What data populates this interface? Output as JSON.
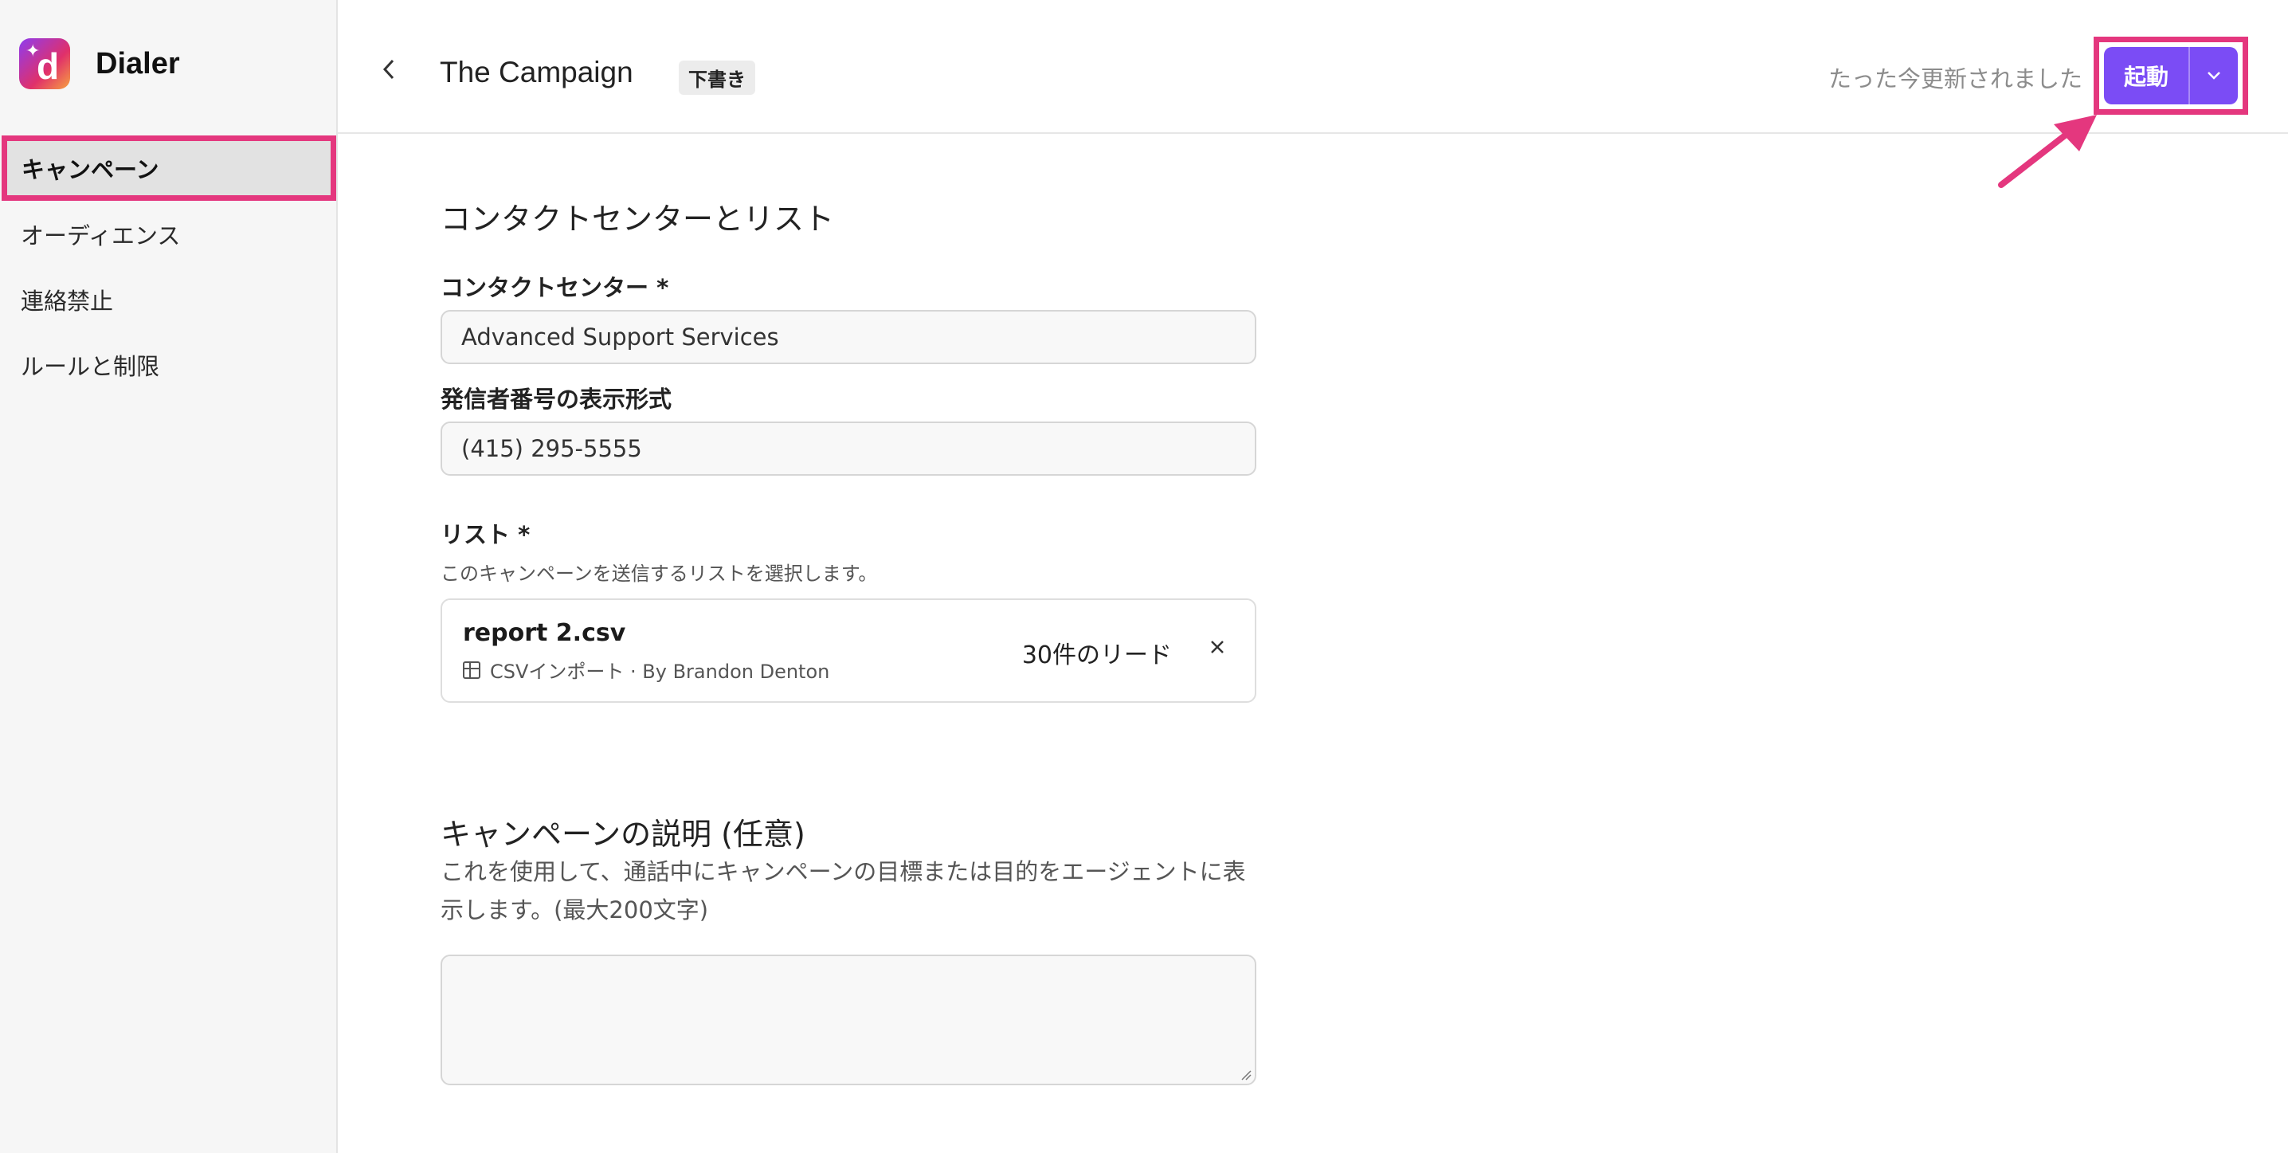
{
  "app": {
    "name": "Dialer"
  },
  "sidebar": {
    "items": [
      {
        "label": "キャンペーン",
        "active": true
      },
      {
        "label": "オーディエンス"
      },
      {
        "label": "連絡禁止"
      },
      {
        "label": "ルールと制限"
      }
    ]
  },
  "header": {
    "title": "The Campaign",
    "badge": "下書き",
    "status": "たった今更新されました",
    "launch_label": "起動"
  },
  "form": {
    "section1_title": "コンタクトセンターとリスト",
    "contact_center_label": "コンタクトセンター *",
    "contact_center_value": "Advanced Support Services",
    "caller_id_label": "発信者番号の表示形式",
    "caller_id_value": "(415) 295-5555",
    "list_label": "リスト *",
    "list_help": "このキャンペーンを送信するリストを選択します。",
    "list_file": {
      "name": "report 2.csv",
      "meta": "CSVインポート · By Brandon Denton",
      "count": "30件のリード"
    },
    "desc_title": "キャンペーンの説明 (任意)",
    "desc_help": "これを使用して、通話中にキャンペーンの目標または目的をエージェントに表示します。(最大200文字)",
    "desc_value": ""
  },
  "colors": {
    "accent": "#7b4cf5",
    "highlight": "#e4377e"
  }
}
